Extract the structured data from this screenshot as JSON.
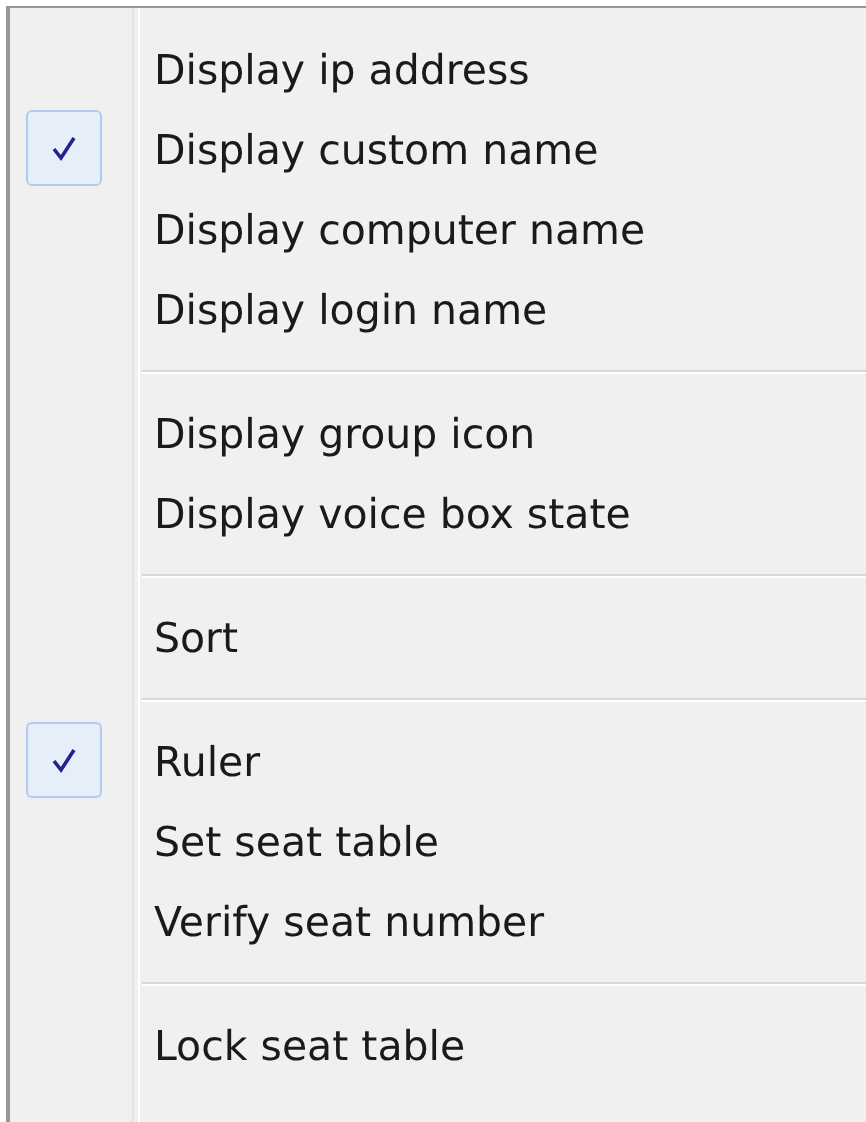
{
  "menu": {
    "groups": [
      {
        "items": [
          {
            "label": "Display ip address",
            "checked": false
          },
          {
            "label": "Display custom name",
            "checked": true
          },
          {
            "label": "Display computer name",
            "checked": false
          },
          {
            "label": "Display login name",
            "checked": false
          }
        ]
      },
      {
        "items": [
          {
            "label": "Display group icon",
            "checked": false
          },
          {
            "label": "Display voice box state",
            "checked": false
          }
        ]
      },
      {
        "items": [
          {
            "label": "Sort",
            "checked": false
          }
        ]
      },
      {
        "items": [
          {
            "label": "Ruler",
            "checked": true
          },
          {
            "label": "Set seat table",
            "checked": false
          },
          {
            "label": "Verify seat number",
            "checked": false
          }
        ]
      },
      {
        "items": [
          {
            "label": "Lock seat table",
            "checked": false
          }
        ]
      }
    ]
  }
}
